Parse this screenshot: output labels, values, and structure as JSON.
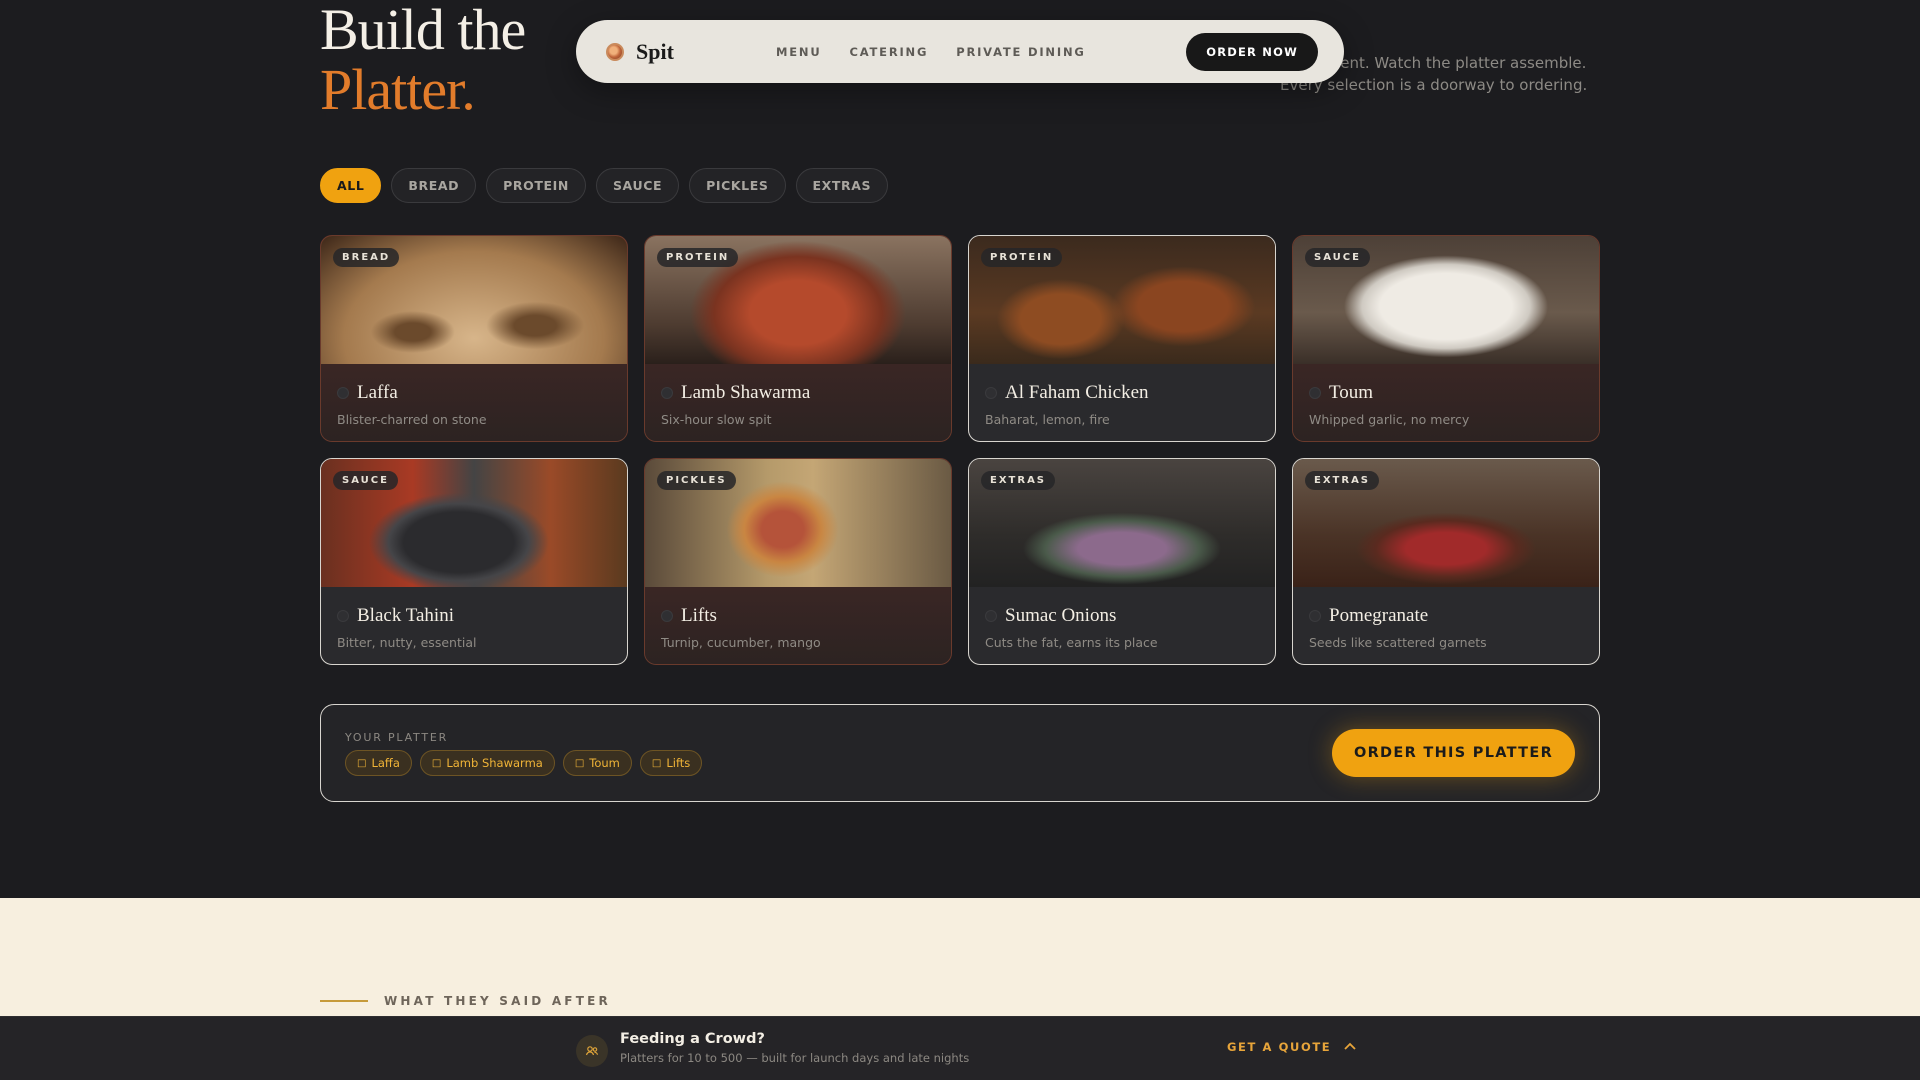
{
  "hero": {
    "line1": "Build the",
    "line2": "Platter.",
    "intro_visible": "component. Watch the platter assemble. Every selection is a doorway to ordering."
  },
  "nav": {
    "brand": "Spit",
    "links": [
      "MENU",
      "CATERING",
      "PRIVATE DINING"
    ],
    "cta": "ORDER NOW"
  },
  "filters": [
    "ALL",
    "BREAD",
    "PROTEIN",
    "SAUCE",
    "PICKLES",
    "EXTRAS"
  ],
  "active_filter": "ALL",
  "cards": [
    {
      "tag": "BREAD",
      "name": "Laffa",
      "desc": "Blister-charred on stone",
      "selected": true
    },
    {
      "tag": "PROTEIN",
      "name": "Lamb Shawarma",
      "desc": "Six-hour slow spit",
      "selected": true
    },
    {
      "tag": "PROTEIN",
      "name": "Al Faham Chicken",
      "desc": "Baharat, lemon, fire",
      "selected": false
    },
    {
      "tag": "SAUCE",
      "name": "Toum",
      "desc": "Whipped garlic, no mercy",
      "selected": true
    },
    {
      "tag": "SAUCE",
      "name": "Black Tahini",
      "desc": "Bitter, nutty, essential",
      "selected": false
    },
    {
      "tag": "PICKLES",
      "name": "Lifts",
      "desc": "Turnip, cucumber, mango",
      "selected": true
    },
    {
      "tag": "EXTRAS",
      "name": "Sumac Onions",
      "desc": "Cuts the fat, earns its place",
      "selected": false
    },
    {
      "tag": "EXTRAS",
      "name": "Pomegranate",
      "desc": "Seeds like scattered garnets",
      "selected": false
    }
  ],
  "platter": {
    "label": "YOUR PLATTER",
    "chips": [
      "Laffa",
      "Lamb Shawarma",
      "Toum",
      "Lifts"
    ],
    "order_label": "ORDER THIS PLATTER"
  },
  "testimonials": {
    "label": "WHAT THEY SAID AFTER"
  },
  "bottom": {
    "title": "Feeding a Crowd?",
    "subtitle": "Platters for 10 to 500 — built for launch days and late nights",
    "cta": "GET A QUOTE"
  },
  "colors": {
    "accent": "#f0a210",
    "headline_accent": "#e27c2b",
    "bg": "#1c1c1f",
    "cream": "#f7efdf"
  }
}
